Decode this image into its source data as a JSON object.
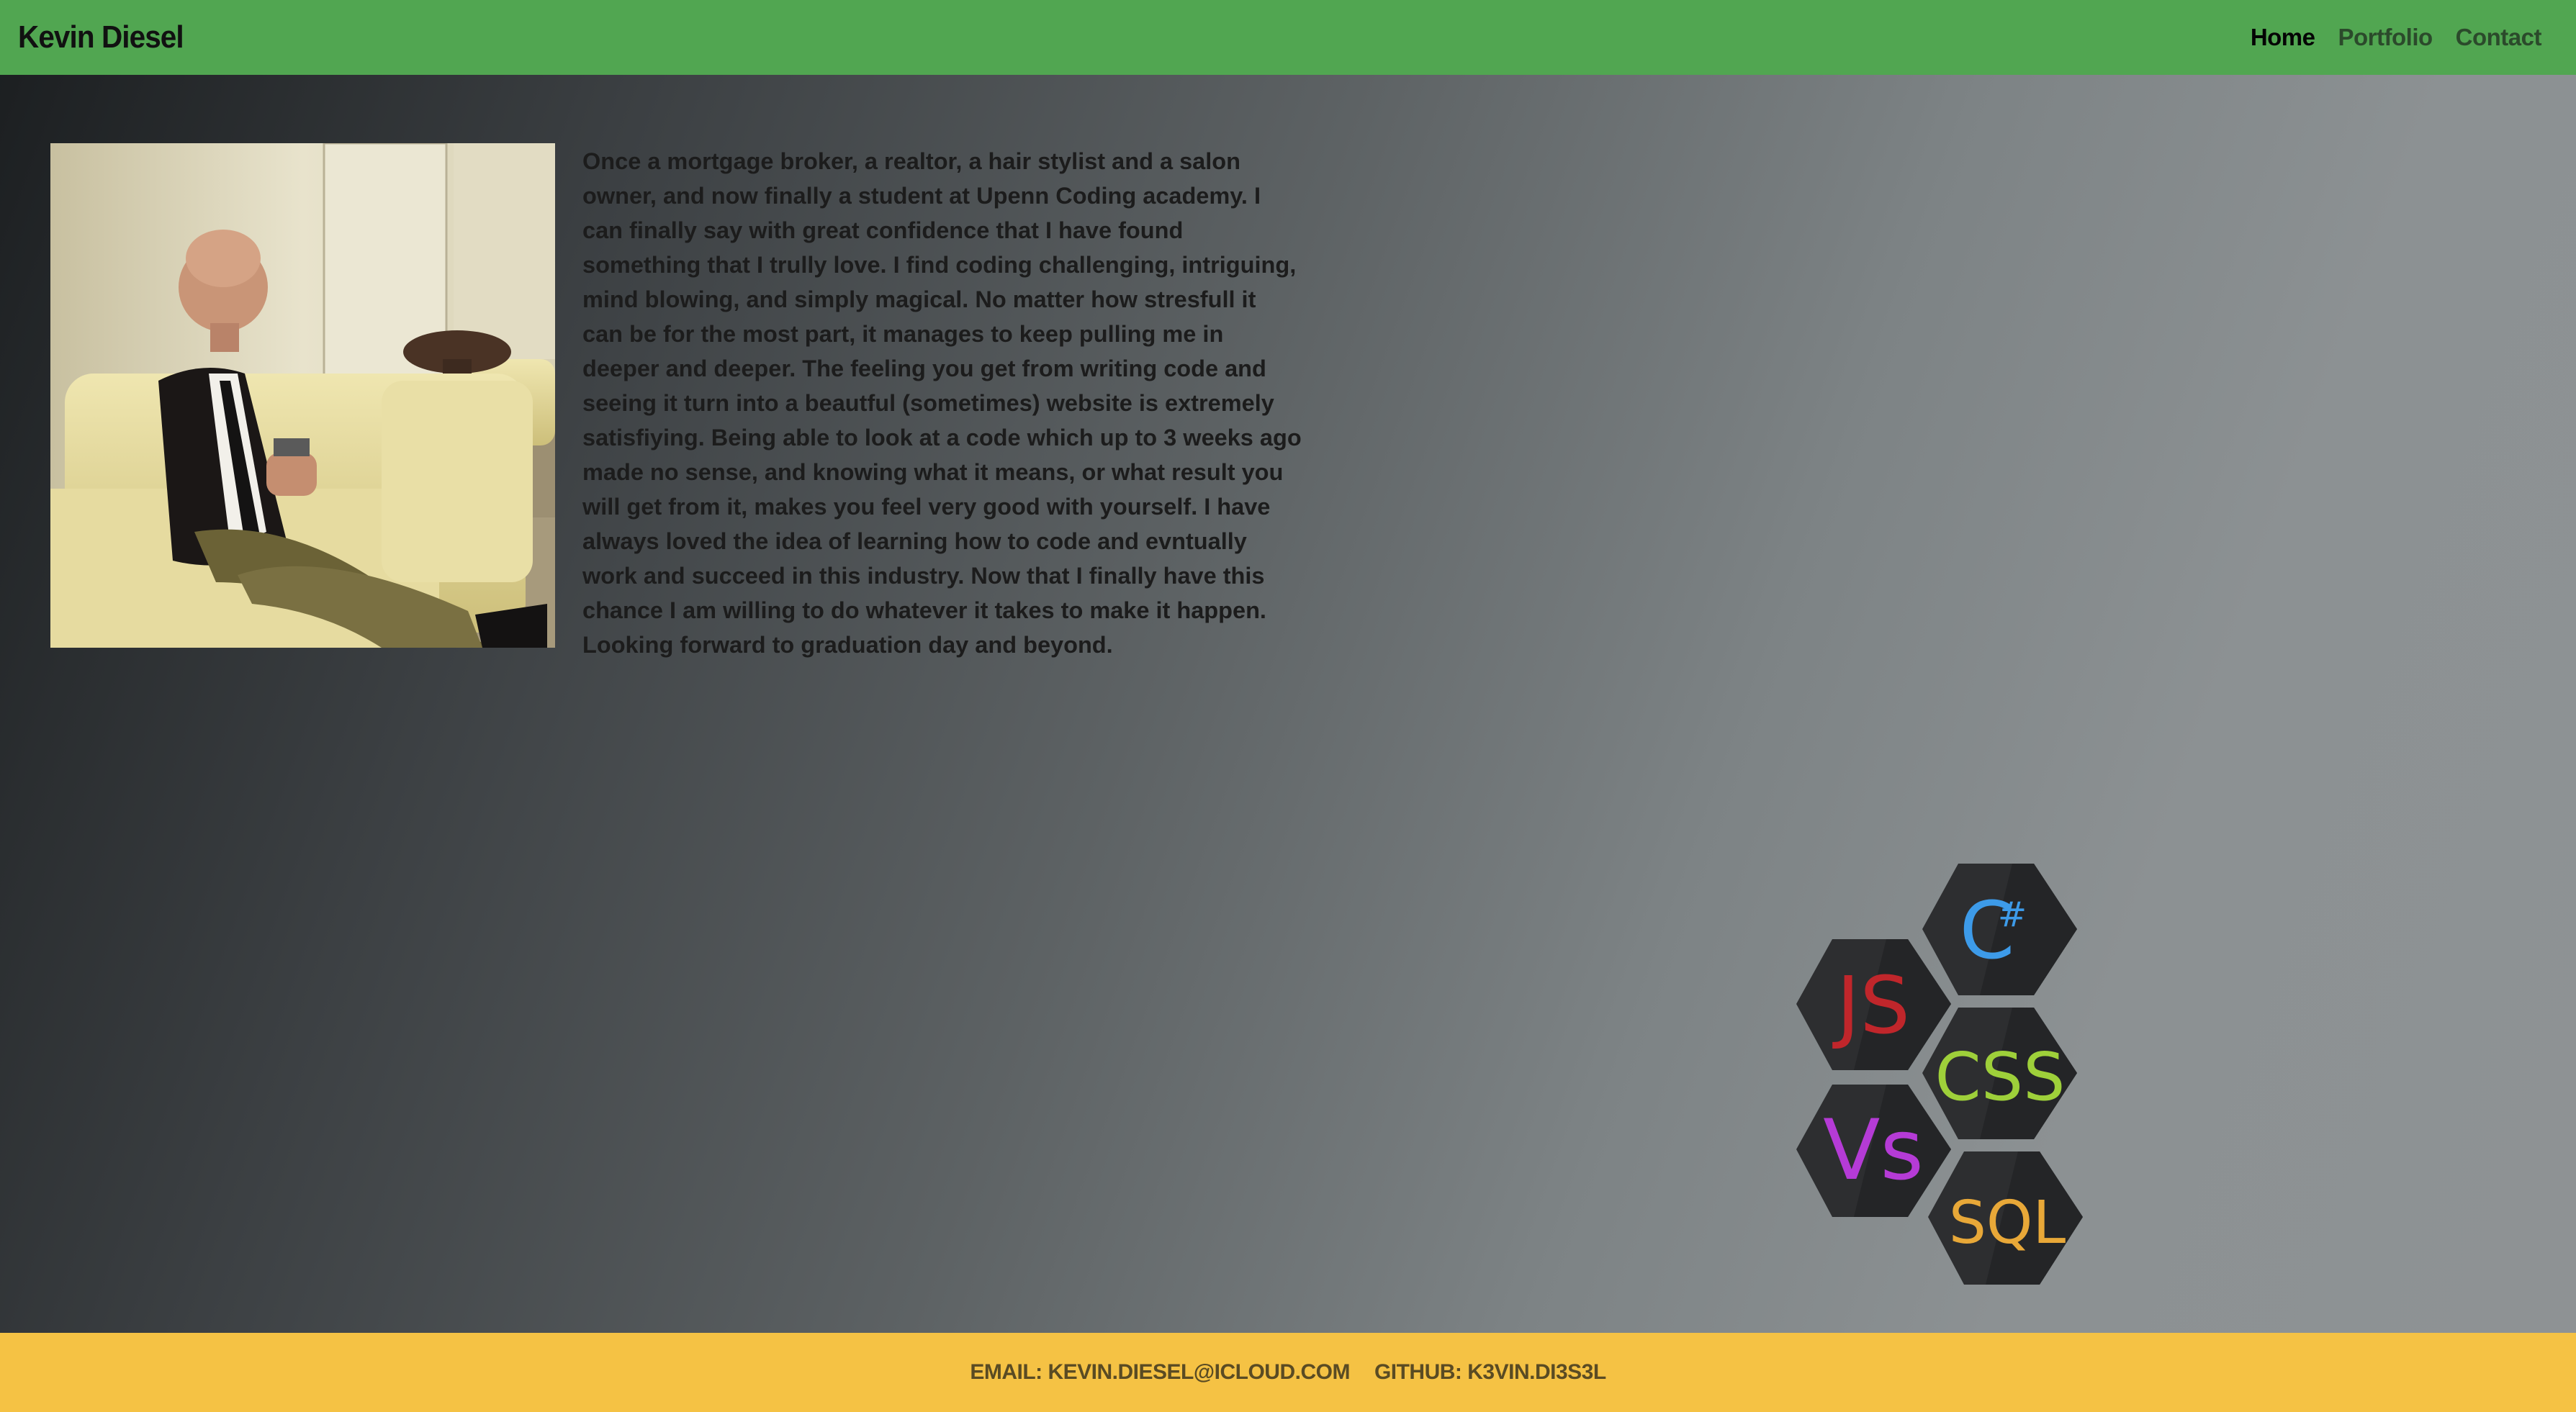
{
  "navbar": {
    "brand": "Kevin Diesel",
    "links": [
      "Home",
      "Portfolio",
      "Contact"
    ],
    "bg_color": "#51a651"
  },
  "about": {
    "photo_alt": "Kevin Diesel portrait",
    "text": "Once a mortgage broker, a realtor, a hair stylist and a salon owner, and now finally a student at Upenn Coding academy. I can finally say with great confidence that I have found something that I trully love. I find coding challenging, intriguing, mind blowing, and simply magical. No matter how stresfull it can be for the most part, it manages to keep pulling me in deeper and deeper. The feeling you get from writing code and seeing it turn into a beautful (sometimes) website is extremely satisfiying. Being able to look at a code which up to 3 weeks ago made no sense, and knowing what it means, or what result you will get from it, makes you feel very good with yourself. I have always loved the idea of learning how to code and evntually work and succeed in this industry. Now that I finally have this chance I am willing to do whatever it takes to make it happen. Looking forward to graduation day and beyond."
  },
  "skills": {
    "badges": [
      {
        "label": "C",
        "sup": "#",
        "color": "#3d9be9"
      },
      {
        "label": "JS",
        "color": "#c0262b"
      },
      {
        "label": "CSS",
        "color": "#9ed03a"
      },
      {
        "label": "Vs",
        "color": "#b53bd6"
      },
      {
        "label": "SQL",
        "color": "#e8a838"
      }
    ]
  },
  "footer": {
    "email": "EMAIL: KEVIN.DIESEL@ICLOUD.COM",
    "github": "GITHUB: K3VIN.DI3S3L",
    "bg_color": "#f5c244"
  }
}
